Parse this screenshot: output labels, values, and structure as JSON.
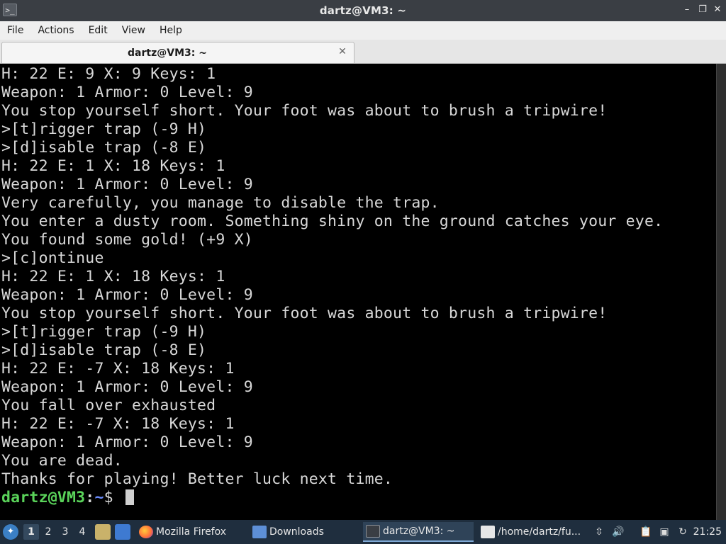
{
  "window": {
    "title": "dartz@VM3: ~",
    "icon": "terminal-icon",
    "controls": [
      "minimize-icon",
      "restore-icon",
      "close-icon"
    ]
  },
  "menu": [
    "File",
    "Actions",
    "Edit",
    "View",
    "Help"
  ],
  "tab": {
    "label": "dartz@VM3: ~",
    "close_icon": "close-icon"
  },
  "terminal": {
    "lines": [
      "H: 22 E: 9 X: 9 Keys: 1",
      "Weapon: 1 Armor: 0 Level: 9",
      "You stop yourself short. Your foot was about to brush a tripwire!",
      ">[t]rigger trap (-9 H)",
      ">[d]isable trap (-8 E)",
      "H: 22 E: 1 X: 18 Keys: 1",
      "Weapon: 1 Armor: 0 Level: 9",
      "Very carefully, you manage to disable the trap.",
      "You enter a dusty room. Something shiny on the ground catches your eye.",
      "You found some gold! (+9 X)",
      ">[c]ontinue",
      "H: 22 E: 1 X: 18 Keys: 1",
      "Weapon: 1 Armor: 0 Level: 9",
      "You stop yourself short. Your foot was about to brush a tripwire!",
      ">[t]rigger trap (-9 H)",
      ">[d]isable trap (-8 E)",
      "H: 22 E: -7 X: 18 Keys: 1",
      "Weapon: 1 Armor: 0 Level: 9",
      "You fall over exhausted",
      "H: 22 E: -7 X: 18 Keys: 1",
      "Weapon: 1 Armor: 0 Level: 9",
      "You are dead.",
      "Thanks for playing! Better luck next time."
    ],
    "prompt": {
      "user_host": "dartz@VM3",
      "sep": ":",
      "path": "~",
      "symbol": "$ "
    }
  },
  "taskbar": {
    "start_icon": "start-menu-icon",
    "workspaces": [
      "1",
      "2",
      "3",
      "4"
    ],
    "active_workspace": "1",
    "launchers": [
      "file-manager-icon",
      "show-desktop-icon"
    ],
    "tasks": [
      {
        "label": "Mozilla Firefox",
        "icon": "firefox-icon"
      },
      {
        "label": "Downloads",
        "icon": "folder-icon"
      },
      {
        "label": "dartz@VM3: ~",
        "icon": "terminal-icon",
        "active": true
      },
      {
        "label": "/home/dartz/fu...",
        "icon": "text-editor-icon"
      }
    ],
    "tray": [
      "scroll-indicator-icon",
      "volume-icon",
      "clipboard-icon",
      "network-icon",
      "update-icon"
    ],
    "clock": "21:25"
  },
  "colors": {
    "titlebar": "#3a3e44",
    "terminal_bg": "#000000",
    "terminal_fg": "#d8d8d8",
    "prompt_user": "#5ad35a",
    "prompt_path": "#6a8cff",
    "taskbar": "#1f2e3e"
  }
}
